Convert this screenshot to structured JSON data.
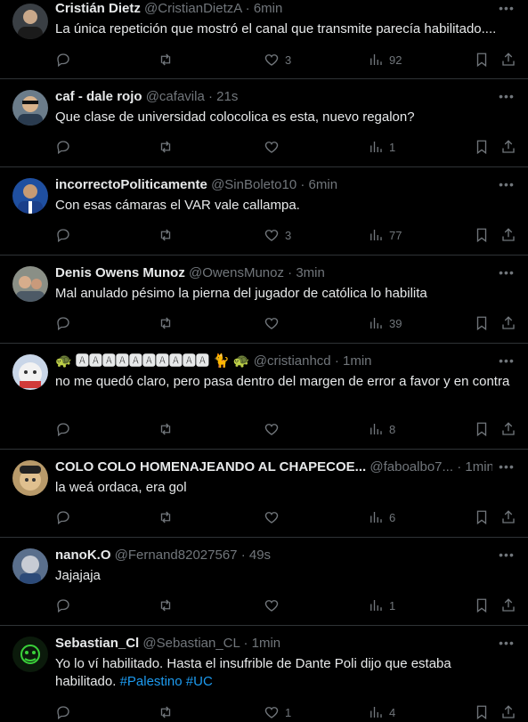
{
  "tweets": [
    {
      "name": "Cristián Dietz",
      "handle": "@CristianDietzA",
      "time": "6min",
      "text": "La única repetición que mostró el canal que transmite parecía habilitado....",
      "replies": "",
      "retweets": "",
      "likes": "3",
      "views": "92",
      "avatar_color": "#3a3f44"
    },
    {
      "name": "caf - dale rojo",
      "handle": "@cafavila",
      "time": "21s",
      "text": "Que clase de universidad colocolica es esta, nuevo regalon?",
      "replies": "",
      "retweets": "",
      "likes": "",
      "views": "1",
      "avatar_color": "#6b7c8a"
    },
    {
      "name": "incorrectoPoliticamente",
      "handle": "@SinBoleto10",
      "time": "6min",
      "text": "Con esas cámaras el VAR vale callampa.",
      "replies": "",
      "retweets": "",
      "likes": "3",
      "views": "77",
      "avatar_color": "#1f4fa0"
    },
    {
      "name": "Denis Owens Munoz",
      "handle": "@OwensMunoz",
      "time": "3min",
      "text": "Mal anulado pésimo la pierna del jugador de católica lo habilita",
      "replies": "",
      "retweets": "",
      "likes": "",
      "views": "39",
      "avatar_color": "#8a8f86"
    },
    {
      "name": "🐢 🅰🅰🅰🅰🅰🅰🅰🅰🅰🅰 🐈 🐢",
      "handle": "@cristianhcd",
      "time": "1min",
      "text": "no me quedó claro, pero pasa dentro del margen de error a favor y en contra",
      "replies": "",
      "retweets": "",
      "likes": "",
      "views": "8",
      "avatar_color": "#c9d6e8"
    },
    {
      "name": "COLO COLO HOMENAJEANDO AL CHAPECOE...",
      "handle": "@faboalbo7...",
      "time": "1min",
      "text": "la weá ordaca, era gol",
      "replies": "",
      "retweets": "",
      "likes": "",
      "views": "6",
      "avatar_color": "#b89a6a"
    },
    {
      "name": "nanoK.O",
      "handle": "@Fernand82027567",
      "time": "49s",
      "text": "Jajajaja",
      "replies": "",
      "retweets": "",
      "likes": "",
      "views": "1",
      "avatar_color": "#5a6f8c"
    },
    {
      "name": "Sebastian_Cl",
      "handle": "@Sebastian_CL",
      "time": "1min",
      "text": "Yo lo ví habilitado. Hasta el insufrible de Dante Poli dijo que estaba habilitado.",
      "hashtags": "#Palestino #UC",
      "replies": "",
      "retweets": "",
      "likes": "1",
      "views": "4",
      "avatar_color": "#0b1a0b"
    }
  ],
  "colors": {
    "background": "#000000",
    "text": "#e7e9ea",
    "muted": "#71767b",
    "link": "#1d9bf0",
    "divider": "#2f3336"
  },
  "icons": [
    "reply-icon",
    "retweet-icon",
    "like-icon",
    "views-icon",
    "bookmark-icon",
    "share-icon",
    "more-icon"
  ]
}
